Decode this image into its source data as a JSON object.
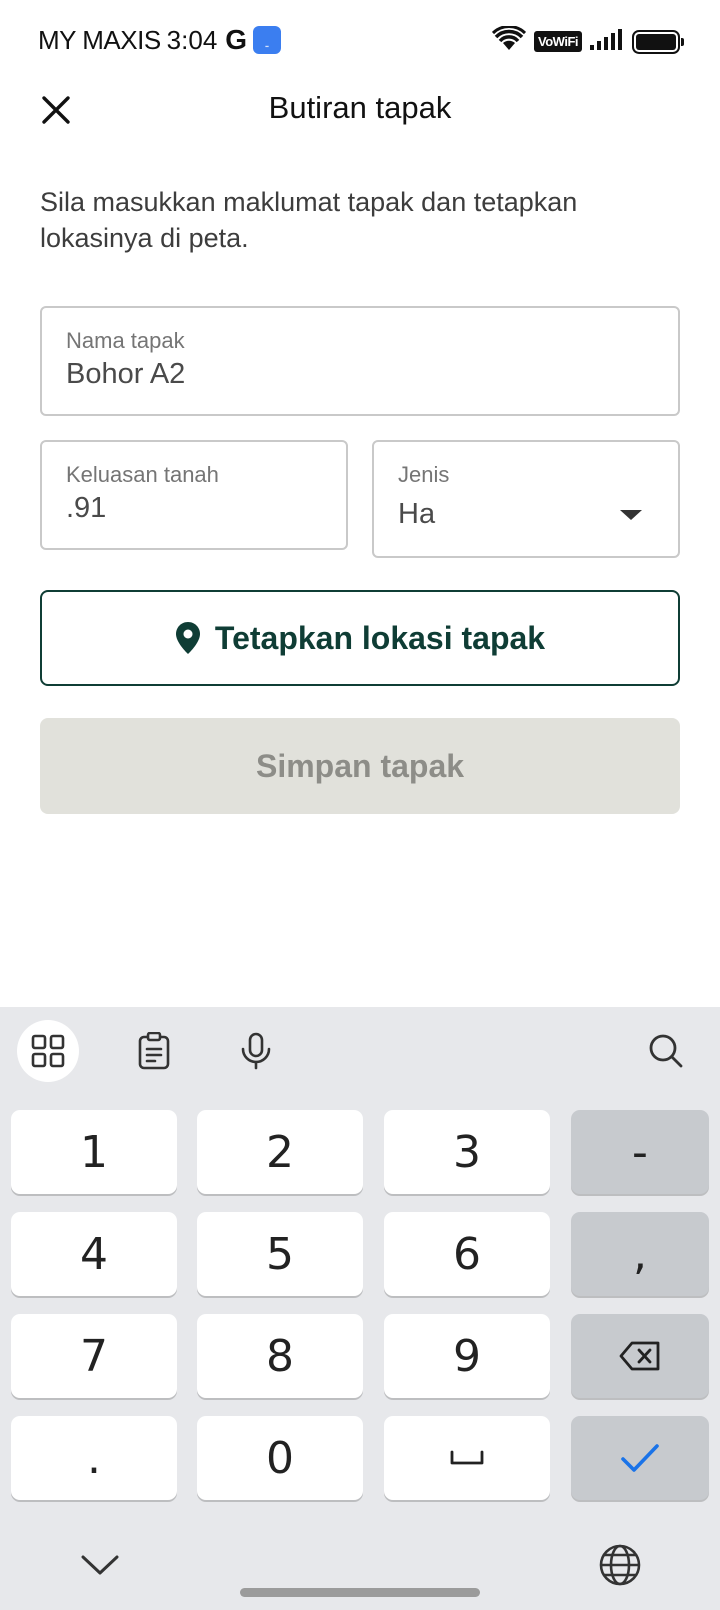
{
  "status_bar": {
    "carrier": "MY MAXIS",
    "time": "3:04",
    "g_label": "G",
    "vowifi": "VoWiFi",
    "icons": [
      "wifi-icon",
      "signal-icon",
      "battery-icon"
    ]
  },
  "header": {
    "title": "Butiran tapak",
    "close_icon": "close-icon"
  },
  "intro_text": "Sila masukkan maklumat tapak dan tetapkan lokasinya di peta.",
  "fields": {
    "name": {
      "label": "Nama tapak",
      "value": "Bohor A2"
    },
    "area": {
      "label": "Keluasan tanah",
      "value": ".91"
    },
    "type": {
      "label": "Jenis",
      "value": "Ha"
    }
  },
  "buttons": {
    "set_location": {
      "label": "Tetapkan lokasi tapak",
      "icon": "location-pin-icon"
    },
    "save": {
      "label": "Simpan tapak"
    }
  },
  "keyboard": {
    "toolbar": [
      "grid-icon",
      "clipboard-icon",
      "mic-icon",
      "search-icon"
    ],
    "keys": {
      "k1": "1",
      "k2": "2",
      "k3": "3",
      "minus": "-",
      "k4": "4",
      "k5": "5",
      "k6": "6",
      "comma": ",",
      "k7": "7",
      "k8": "8",
      "k9": "9",
      "dot": ".",
      "k0": "0",
      "space": "␣"
    }
  },
  "colors": {
    "primary": "#0f3d35",
    "disabled_bg": "#e1e1db",
    "disabled_text": "#8d8d88",
    "keyboard_bg": "#e7e8eb",
    "enter_check": "#1a73e8"
  }
}
